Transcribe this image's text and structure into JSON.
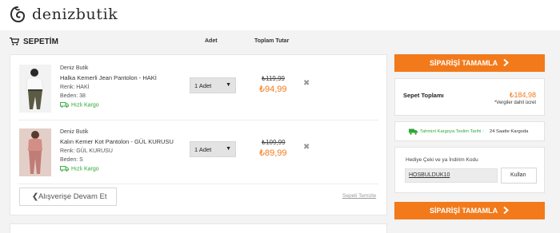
{
  "header": {
    "logo_text": "denizbutik"
  },
  "cart": {
    "title": "SEPETİM",
    "col_qty": "Adet",
    "col_total": "Toplam Tutar",
    "items": [
      {
        "brand": "Deniz Butik",
        "name": "Halka Kemerli Jean Pantolon - HAKİ",
        "color": "Renk: HAKİ",
        "size": "Beden: 38",
        "shipping": "Hızlı Kargo",
        "qty": "1 Adet",
        "old_price": "₺119,99",
        "price": "₺94,99"
      },
      {
        "brand": "Deniz Butik",
        "name": "Kalın Kemer Kot Pantolon - GÜL KURUSU",
        "color": "Renk: GÜL KURUSU",
        "size": "Beden: S",
        "shipping": "Hızlı Kargo",
        "qty": "1 Adet",
        "old_price": "₺109,99",
        "price": "₺89,99"
      }
    ],
    "continue_label": "Alışverişe Devam Et",
    "clear_label": "Sepeti Temizle"
  },
  "sidebar": {
    "confirm_label": "SİPARİŞİ TAMAMLA",
    "total_label": "Sepet Toplamı",
    "total_value": "₺184,98",
    "tax_note": "*Vergiler dahil ücret",
    "delivery_label": "Tahmini Kargoya Teslim Tarihi :",
    "delivery_value": "24 Saatte Kargoda",
    "coupon_label": "Hediye Çeki ve ya İndirim Kodu",
    "coupon_value": "HOSBULDUK10",
    "coupon_button": "Kullan"
  },
  "colors": {
    "accent": "#f27a1a",
    "success": "#2ea836"
  },
  "icons": [
    "logo-icon",
    "cart-icon",
    "truck-icon",
    "close-icon",
    "chevron-left-icon",
    "chevron-right-icon",
    "dropdown-arrow-icon"
  ]
}
